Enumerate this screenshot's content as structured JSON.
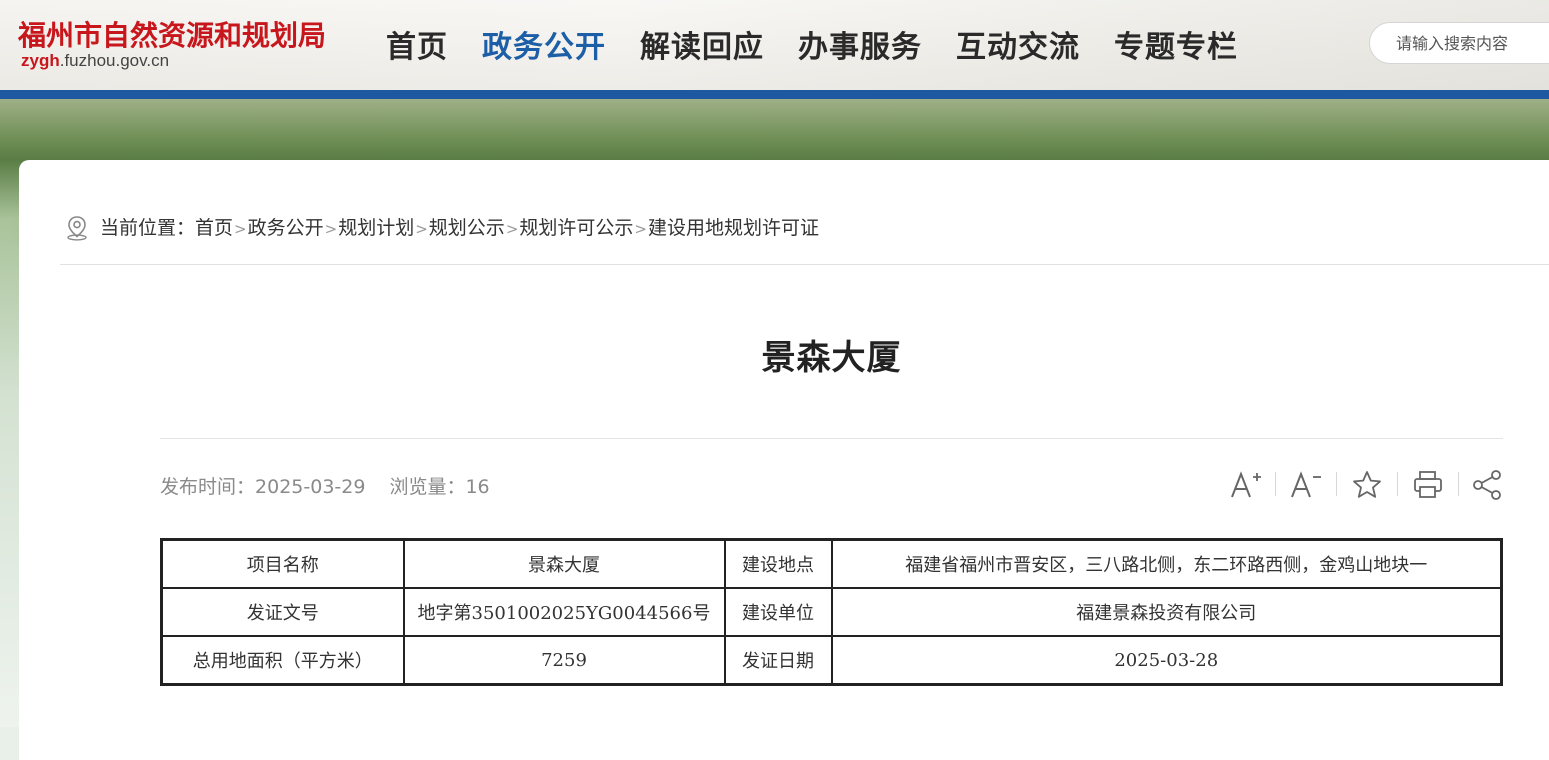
{
  "site": {
    "name": "福州市自然资源和规划局",
    "url_bold": "zygh",
    "url_rest": ".fuzhou.gov.cn"
  },
  "nav": {
    "items": [
      "首页",
      "政务公开",
      "解读回应",
      "办事服务",
      "互动交流",
      "专题专栏"
    ],
    "active": "政务公开"
  },
  "search": {
    "placeholder": "请输入搜索内容"
  },
  "breadcrumb": {
    "label": "当前位置：",
    "items": [
      "首页",
      "政务公开",
      "规划计划",
      "规划公示",
      "规划许可公示",
      "建设用地规划许可证"
    ],
    "separator": ">"
  },
  "article": {
    "title": "景森大厦",
    "publish_label": "发布时间：",
    "publish_date": "2025-03-29",
    "views_label": "浏览量：",
    "views": "16"
  },
  "tools": [
    "font-increase-icon",
    "font-decrease-icon",
    "star-icon",
    "print-icon",
    "share-icon"
  ],
  "table": {
    "rows": [
      [
        "项目名称",
        "景森大厦",
        "建设地点",
        "福建省福州市晋安区，三八路北侧，东二环路西侧，金鸡山地块一"
      ],
      [
        "发证文号",
        "地字第3501002025YG0044566号",
        "建设单位",
        "福建景森投资有限公司"
      ],
      [
        "总用地面积（平方米）",
        "7259",
        "发证日期",
        "2025-03-28"
      ]
    ]
  },
  "colors": {
    "brand_red": "#c8161d",
    "nav_active": "#1d5fa6",
    "blue_bar": "#1d58a0"
  }
}
